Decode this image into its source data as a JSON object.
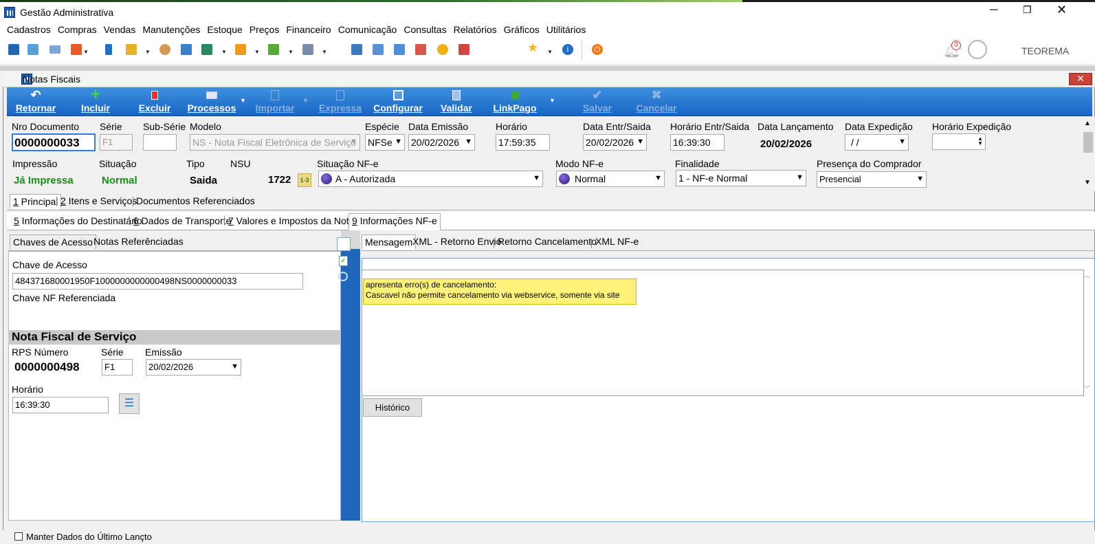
{
  "app": {
    "title": "Gestão Administrativa",
    "user": "TEOREMA",
    "notifications_count": "0"
  },
  "menu": [
    "Cadastros",
    "Compras",
    "Vendas",
    "Manutenções",
    "Estoque",
    "Preços",
    "Financeiro",
    "Comunicação",
    "Consultas",
    "Relatórios",
    "Gráficos",
    "Utilitários"
  ],
  "window": {
    "title": "Notas Fiscais"
  },
  "ribbon": {
    "retornar": "Retornar",
    "incluir": "Incluir",
    "excluir": "Excluir",
    "processos": "Processos",
    "importar": "Importar",
    "expressa": "Expressa",
    "configurar": "Configurar",
    "validar": "Validar",
    "linkpago": "LinkPago",
    "salvar": "Salvar",
    "cancelar": "Cancelar"
  },
  "header": {
    "nro_documento": {
      "label": "Nro Documento",
      "value": "0000000033"
    },
    "serie": {
      "label": "Série",
      "value": "F1"
    },
    "sub_serie": {
      "label": "Sub-Série",
      "value": ""
    },
    "modelo": {
      "label": "Modelo",
      "value": "NS - Nota Fiscal Eletrônica de Serviço"
    },
    "especie": {
      "label": "Espécie",
      "value": "NFSe"
    },
    "data_emissao": {
      "label": "Data Emissão",
      "value": "20/02/2026"
    },
    "horario": {
      "label": "Horário",
      "value": "17:59:35"
    },
    "data_entr_saida": {
      "label": "Data Entr/Saida",
      "value": "20/02/2026"
    },
    "horario_entr_saida": {
      "label": "Horário Entr/Saida",
      "value": "16:39:30"
    },
    "data_lancamento": {
      "label": "Data Lançamento",
      "value": "20/02/2026"
    },
    "data_expedicao": {
      "label": "Data Expedição",
      "value": " / /"
    },
    "horario_expedicao": {
      "label": "Horário Expedição",
      "value": ""
    },
    "impressao": {
      "label": "Impressão",
      "value": "Já Impressa"
    },
    "situacao": {
      "label": "Situação",
      "value": "Normal"
    },
    "tipo": {
      "label": "Tipo",
      "value": "Saida"
    },
    "nsu": {
      "label": "NSU",
      "value": "1722"
    },
    "situacao_nfe": {
      "label": "Situação NF-e",
      "value": "A - Autorizada"
    },
    "modo_nfe": {
      "label": "Modo NF-e",
      "value": "Normal"
    },
    "finalidade": {
      "label": "Finalidade",
      "value": "1 - NF-e Normal"
    },
    "presenca": {
      "label": "Presença do Comprador",
      "value": "Presencial"
    }
  },
  "tabs_row1": [
    {
      "num": "1",
      "label": " Principal"
    },
    {
      "num": "2",
      "label": " Itens e Serviços"
    },
    {
      "num": "",
      "label": "Documentos Referenciados"
    }
  ],
  "tabs_row2": [
    {
      "num": "5",
      "label": " Informações do Destinatário"
    },
    {
      "num": "6",
      "label": " Dados de Transporte"
    },
    {
      "num": "7",
      "label": " Valores e Impostos da Nota"
    },
    {
      "num": "9",
      "label": " Informações NF-e"
    }
  ],
  "left_tabs": [
    "Chaves de Acesso",
    "Notas Referênciadas"
  ],
  "chave": {
    "label": "Chave de Acesso",
    "value": "484371680001950F1000000000000498NS0000000033",
    "ref_label": "Chave NF Referenciada"
  },
  "nfs": {
    "title": "Nota Fiscal de Serviço",
    "rps_label": "RPS Número",
    "rps_value": "0000000498",
    "serie_label": "Série",
    "serie_value": "F1",
    "emissao_label": "Emissão",
    "emissao_value": "20/02/2026",
    "horario_label": "Horário",
    "horario_value": "16:39:30"
  },
  "right_tabs": [
    "Mensagem",
    "XML - Retorno Envio",
    "Retorno Cancelamento",
    "XML NF-e"
  ],
  "message": {
    "line1": "apresenta erro(s) de cancelamento:",
    "line2": "Cascavel não permite cancelamento via webservice, somente via site"
  },
  "historico": "Histórico",
  "footer": {
    "checkbox_label": "Manter Dados do Último Lançto"
  }
}
